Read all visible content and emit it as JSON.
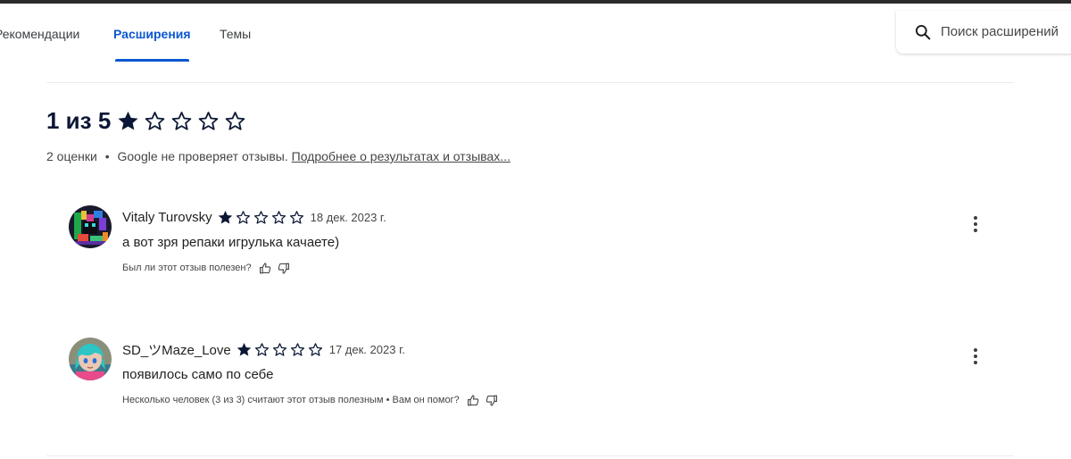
{
  "nav": {
    "tabs": [
      "Рекомендации",
      "Расширения",
      "Темы"
    ],
    "active_tab": "Расширения",
    "search_placeholder": "Поиск расширений",
    "accent_color": "#0b57d0"
  },
  "rating": {
    "label": "1 из 5",
    "value": 1,
    "max": 5,
    "count_text": "2 оценки",
    "separator": "•",
    "notice": "Google не проверяет отзывы.",
    "link_text": "Подробнее о результатах и отзывах..."
  },
  "reviews": [
    {
      "author": "Vitaly Turovsky",
      "stars": 1,
      "date": "18 дек. 2023 г.",
      "text": "а вот зря репаки игрулька качаете)",
      "helpful_text": "Был ли этот отзыв полезен?",
      "avatar_icon": "pixel-art-avatar"
    },
    {
      "author": "SD_ツMaze_Love",
      "stars": 1,
      "date": "17 дек. 2023 г.",
      "text": "появилось само по себе",
      "helpful_text": "Несколько человек (3 из 3) считают этот отзыв полезным • Вам он помог?",
      "avatar_icon": "anime-avatar"
    }
  ],
  "icons": {
    "search": "search-icon",
    "star_full": "star-filled-icon",
    "star_empty": "star-outline-icon",
    "thumb_up": "thumb-up-icon",
    "thumb_down": "thumb-down-icon",
    "more": "more-vert-icon"
  }
}
